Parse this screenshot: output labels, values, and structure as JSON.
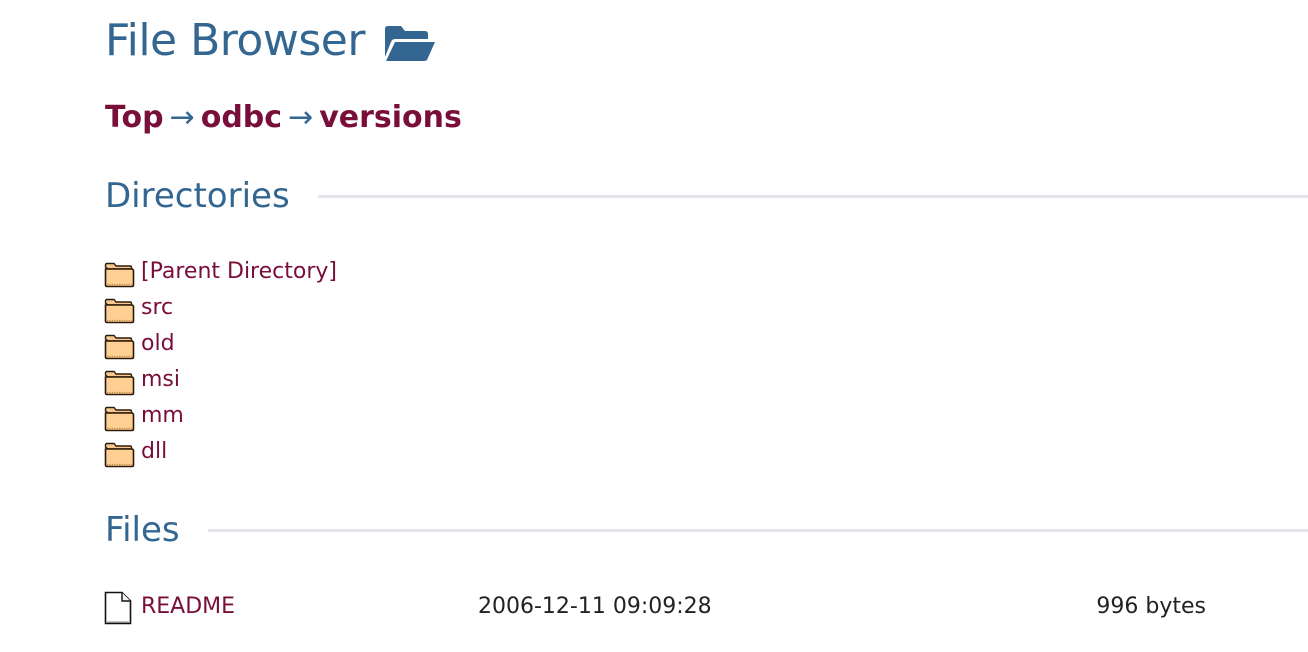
{
  "header": {
    "title": "File Browser",
    "title_icon": "folder-open-icon",
    "accent_color": "#336791"
  },
  "breadcrumb": {
    "items": [
      "Top",
      "odbc",
      "versions"
    ],
    "separator": "→",
    "link_color": "#7a0e3a"
  },
  "directories": {
    "heading": "Directories",
    "icon": "folder-icon",
    "items": [
      {
        "label": "[Parent Directory]"
      },
      {
        "label": "src"
      },
      {
        "label": "old"
      },
      {
        "label": "msi"
      },
      {
        "label": "mm"
      },
      {
        "label": "dll"
      }
    ]
  },
  "files": {
    "heading": "Files",
    "icon": "file-icon",
    "rows": [
      {
        "name": "README",
        "modified": "2006-12-11 09:09:28",
        "size": "996 bytes"
      }
    ]
  }
}
